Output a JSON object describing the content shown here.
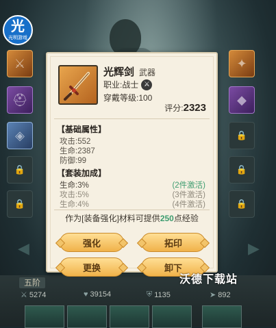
{
  "logo": {
    "main": "光",
    "sub": "光明游戏"
  },
  "dialog": {
    "item_name": "光辉剑",
    "item_type": "武器",
    "class_label": "职业:战士",
    "level_label": "穿戴等级:100",
    "score_label": "评分:",
    "score_value": "2323",
    "base_title": "【基础属性】",
    "base_attrs": [
      "攻击:552",
      "生命:2387",
      "防御:99"
    ],
    "set_title": "【套装加成】",
    "set_bonuses": [
      {
        "text": "生命:3%",
        "status": "(2件激活)",
        "active": true
      },
      {
        "text": "攻击:5%",
        "status": "(3件激活)",
        "active": false
      },
      {
        "text": "生命:4%",
        "status": "(4件激活)",
        "active": false
      }
    ],
    "exp_prefix": "作为[装备强化]材料可提供",
    "exp_value": "250",
    "exp_suffix": "点经验",
    "buttons": {
      "strengthen": "强化",
      "rubbing": "拓印",
      "replace": "更换",
      "unequip": "卸下"
    }
  },
  "bottom": {
    "rank": "五阶",
    "stats": [
      "5274",
      "39154",
      "1135",
      "892"
    ]
  },
  "watermark": "沃德下载站",
  "colors": {
    "accent_gold": "#f0b24a",
    "set_active": "#3d9c6f",
    "dialog_bg": "#f6f0e2"
  }
}
